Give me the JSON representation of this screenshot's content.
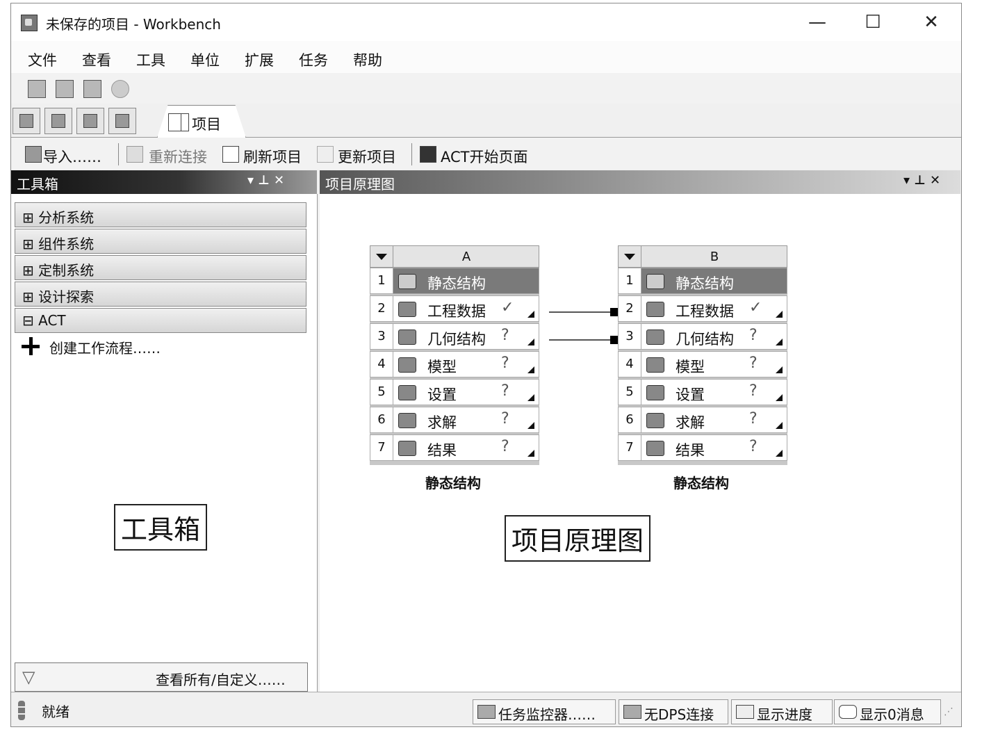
{
  "window": {
    "title": "未保存的项目 - Workbench",
    "controls": [
      "—",
      "☐",
      "✕"
    ]
  },
  "menu": [
    "文件",
    "查看",
    "工具",
    "单位",
    "扩展",
    "任务",
    "帮助"
  ],
  "tab": {
    "label": "项目"
  },
  "toolbar2": {
    "import": "导入……",
    "reconnect": "重新连接",
    "refresh": "刷新项目",
    "update": "更新项目",
    "act_start": "ACT开始页面"
  },
  "toolbox": {
    "header": "工具箱",
    "panel_buttons": "▾ ⊥ ✕",
    "categories": [
      {
        "sign": "⊞",
        "label": "分析系统"
      },
      {
        "sign": "⊞",
        "label": "组件系统"
      },
      {
        "sign": "⊞",
        "label": "定制系统"
      },
      {
        "sign": "⊞",
        "label": "设计探索"
      },
      {
        "sign": "⊟",
        "label": "ACT"
      }
    ],
    "create_workflow": "创建工作流程……",
    "annotation": "工具箱",
    "filter_label": "查看所有/自定义……"
  },
  "schematic": {
    "header": "项目原理图",
    "panel_buttons": "▾ ⊥ ✕",
    "annotation": "项目原理图",
    "systems": [
      {
        "letter": "A",
        "caption": "静态结构",
        "rows": [
          {
            "num": "1",
            "label": "静态结构",
            "status": ""
          },
          {
            "num": "2",
            "label": "工程数据",
            "status": "✓"
          },
          {
            "num": "3",
            "label": "几何结构",
            "status": "?"
          },
          {
            "num": "4",
            "label": "模型",
            "status": "?"
          },
          {
            "num": "5",
            "label": "设置",
            "status": "?"
          },
          {
            "num": "6",
            "label": "求解",
            "status": "?"
          },
          {
            "num": "7",
            "label": "结果",
            "status": "?"
          }
        ]
      },
      {
        "letter": "B",
        "caption": "静态结构",
        "rows": [
          {
            "num": "1",
            "label": "静态结构",
            "status": ""
          },
          {
            "num": "2",
            "label": "工程数据",
            "status": "✓"
          },
          {
            "num": "3",
            "label": "几何结构",
            "status": "?"
          },
          {
            "num": "4",
            "label": "模型",
            "status": "?"
          },
          {
            "num": "5",
            "label": "设置",
            "status": "?"
          },
          {
            "num": "6",
            "label": "求解",
            "status": "?"
          },
          {
            "num": "7",
            "label": "结果",
            "status": "?"
          }
        ]
      }
    ]
  },
  "status": {
    "ready": "就绪",
    "task_monitor": "任务监控器……",
    "dps": "无DPS连接",
    "progress": "显示进度",
    "messages": "显示0消息"
  },
  "colors": {
    "toolbox_header_start": "#111111",
    "toolbox_header_end": "#9a9a9a",
    "row_header": "#7a7a7a"
  }
}
